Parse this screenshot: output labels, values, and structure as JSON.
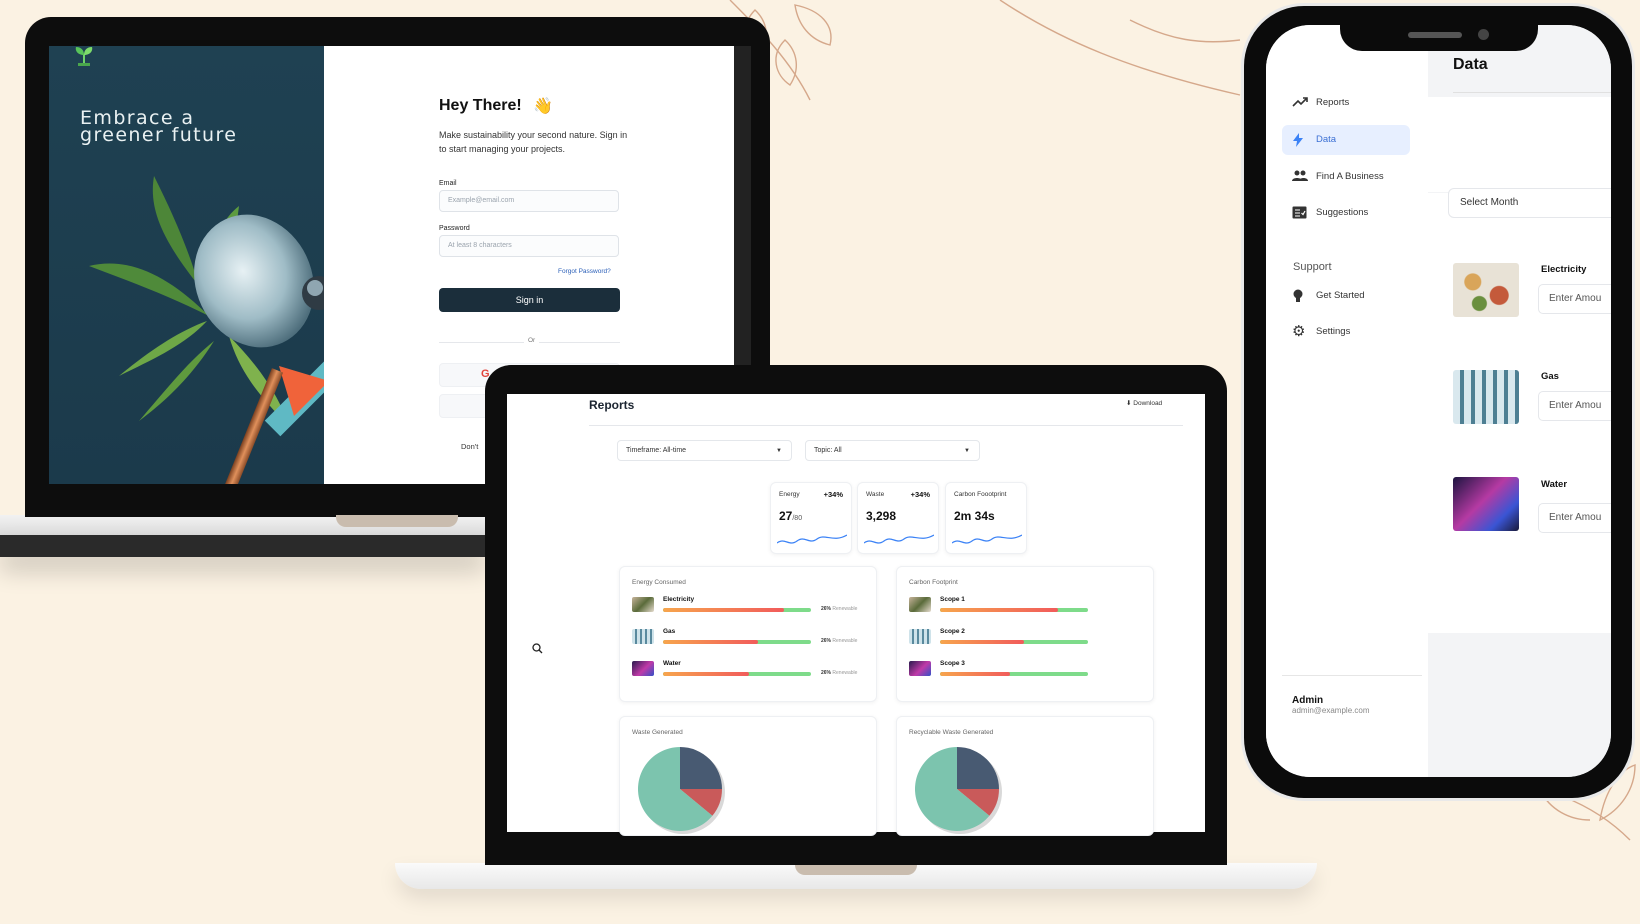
{
  "login": {
    "tagline": "Embrace a greener future",
    "heading": "Hey There!",
    "wave": "👋",
    "subtitle": "Make sustainability your second nature. Sign in to start managing your projects.",
    "email_label": "Email",
    "email_placeholder": "Example@email.com",
    "password_label": "Password",
    "password_placeholder": "At least 8 characters",
    "forgot": "Forgot Password?",
    "signin": "Sign in",
    "or": "Or",
    "signup_prompt": "Don't"
  },
  "reports": {
    "title": "Reports",
    "download": "Download",
    "timeframe_label": "Timeframe:",
    "timeframe_value": "All-time",
    "topic_label": "Topic:",
    "topic_value": "All",
    "kpis": [
      {
        "label": "Energy",
        "pct": "+34%",
        "value": "27",
        "suffix": "/80"
      },
      {
        "label": "Waste",
        "pct": "+34%",
        "value": "3,298",
        "suffix": ""
      },
      {
        "label": "Carbon Foootprint",
        "pct": "",
        "value": "2m 34s",
        "suffix": ""
      }
    ],
    "energy_panel": {
      "title": "Energy Consumed",
      "rows": [
        {
          "name": "Electricity",
          "fill": 0.82,
          "renew_pct": "26%",
          "renew_lbl": "Renewable"
        },
        {
          "name": "Gas",
          "fill": 0.64,
          "renew_pct": "26%",
          "renew_lbl": "Renewable"
        },
        {
          "name": "Water",
          "fill": 0.58,
          "renew_pct": "26%",
          "renew_lbl": "Renewable"
        }
      ]
    },
    "carbon_panel": {
      "title": "Carbon Footprint",
      "rows": [
        {
          "name": "Scope 1",
          "fill": 0.8
        },
        {
          "name": "Scope 2",
          "fill": 0.57
        },
        {
          "name": "Scope 3",
          "fill": 0.47
        }
      ]
    },
    "waste_panel": {
      "title": "Waste Generated"
    },
    "recycle_panel": {
      "title": "Recyclable Waste Generated"
    },
    "colors": {
      "pie_green": "#7cc4ae",
      "pie_navy": "#485a72",
      "pie_red": "#c95a5a"
    }
  },
  "phone": {
    "title": "Data",
    "nav": [
      {
        "label": "Reports",
        "icon": "trend-up-icon"
      },
      {
        "label": "Data",
        "icon": "bolt-icon"
      },
      {
        "label": "Find A Business",
        "icon": "users-icon"
      },
      {
        "label": "Suggestions",
        "icon": "checklist-icon"
      }
    ],
    "support_label": "Support",
    "support_nav": [
      {
        "label": "Get Started",
        "icon": "lightbulb-icon"
      },
      {
        "label": "Settings",
        "icon": "gear-icon"
      }
    ],
    "admin_name": "Admin",
    "admin_email": "admin@example.com",
    "select_month": "Select Month",
    "resources": [
      {
        "name": "Electricity",
        "placeholder": "Enter Amou"
      },
      {
        "name": "Gas",
        "placeholder": "Enter Amou"
      },
      {
        "name": "Water",
        "placeholder": "Enter Amou"
      }
    ]
  }
}
